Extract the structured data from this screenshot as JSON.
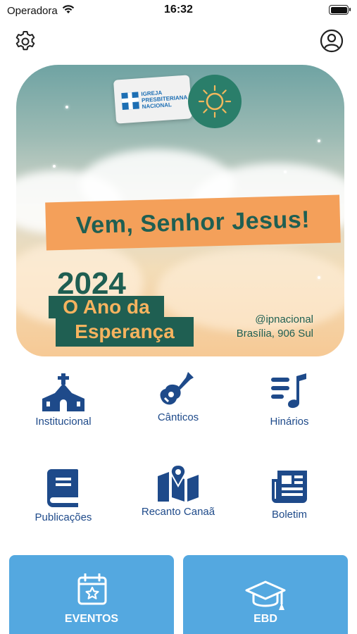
{
  "status_bar": {
    "carrier": "Operadora",
    "time": "16:32"
  },
  "banner": {
    "logo_text": [
      "IGREJA",
      "PRESBITERIANA",
      "NACIONAL"
    ],
    "slogan": "Vem, Senhor Jesus!",
    "year": "2024",
    "theme_line1": "O Ano da",
    "theme_line2": "Esperança",
    "handle": "@ipnacional",
    "address": "Brasília, 906 Sul"
  },
  "menu": {
    "institucional": "Institucional",
    "canticos": "Cânticos",
    "hinarios": "Hinários",
    "publicacoes": "Publicações",
    "recanto": "Recanto Canaã",
    "boletim": "Boletim"
  },
  "cards": {
    "eventos": "EVENTOS",
    "ebd": "EBD"
  },
  "colors": {
    "icon_blue": "#1e4a8a",
    "card_blue": "#54a8e0",
    "banner_green": "#1f5f52",
    "banner_orange": "#f4a05a"
  },
  "icons": [
    "wifi-icon",
    "battery-icon",
    "gear-icon",
    "user-circle-icon",
    "church-icon",
    "guitar-icon",
    "music-list-icon",
    "book-icon",
    "map-pin-icon",
    "newspaper-icon",
    "calendar-star-icon",
    "graduation-cap-icon",
    "sun-icon"
  ]
}
